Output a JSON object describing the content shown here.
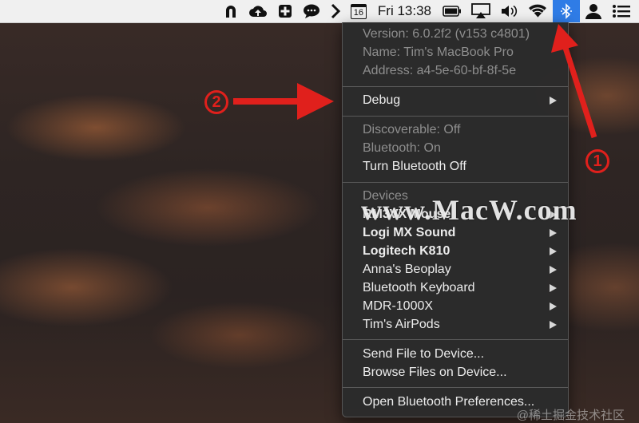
{
  "menubar": {
    "clock": "Fri 13:38",
    "calendar_day": "16",
    "icons": [
      "horseshoe-icon",
      "cloud-upload-icon",
      "first-aid-icon",
      "chat-bubble-icon",
      "chevron-right-icon",
      "calendar-icon",
      "battery-icon",
      "airplay-icon",
      "volume-icon",
      "wifi-icon",
      "bluetooth-icon",
      "user-icon",
      "list-icon"
    ],
    "active_color": "#2f7ce6"
  },
  "menu": {
    "info": {
      "version": "Version: 6.0.2f2 (v153 c4801)",
      "name": "Name: Tim's MacBook Pro",
      "address": "Address: a4-5e-60-bf-8f-5e"
    },
    "debug": "Debug",
    "status": {
      "discoverable": "Discoverable: Off",
      "bluetooth": "Bluetooth: On",
      "toggle": "Turn Bluetooth Off"
    },
    "devices_header": "Devices",
    "devices": [
      {
        "label": "RM3VX Mouse",
        "connected": true
      },
      {
        "label": "Logi MX Sound",
        "connected": true
      },
      {
        "label": "Logitech K810",
        "connected": true
      },
      {
        "label": "Anna's Beoplay",
        "connected": false
      },
      {
        "label": "Bluetooth Keyboard",
        "connected": false
      },
      {
        "label": "MDR-1000X",
        "connected": false
      },
      {
        "label": "Tim's AirPods",
        "connected": false
      }
    ],
    "send_file": "Send File to Device...",
    "browse_files": "Browse Files on Device...",
    "open_prefs": "Open Bluetooth Preferences..."
  },
  "annotations": {
    "badge_1": "1",
    "badge_2": "2",
    "color": "#e0201c"
  },
  "watermark": "www.MacW.com",
  "footer_watermark": "@稀土掘金技术社区"
}
